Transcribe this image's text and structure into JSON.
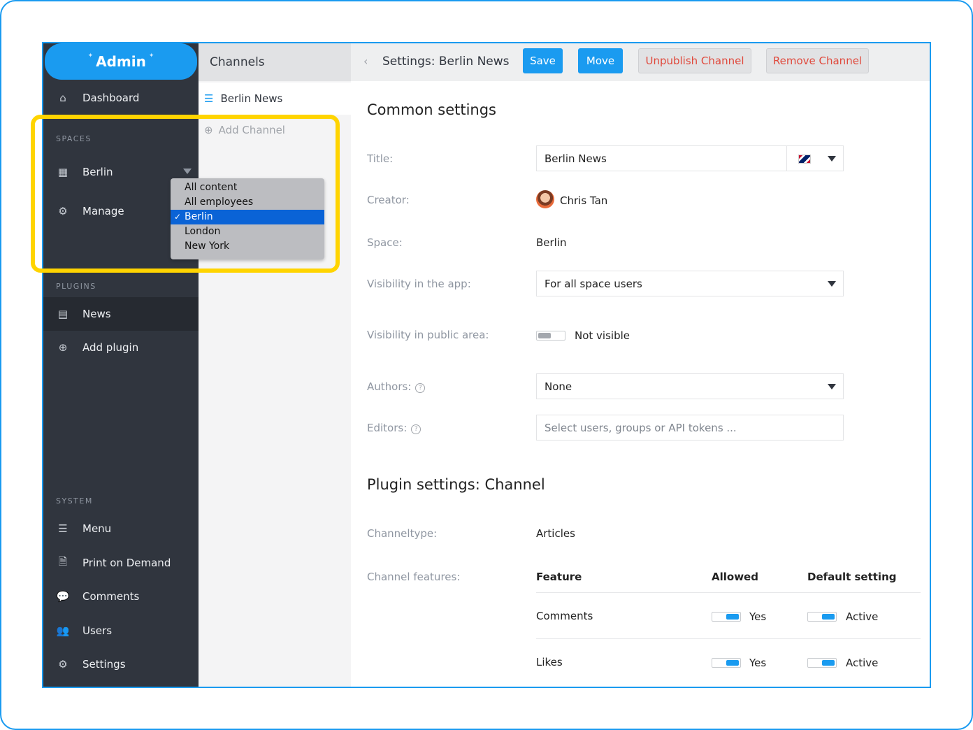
{
  "app": {
    "title": "Admin"
  },
  "sidebar": {
    "dashboard": "Dashboard",
    "spaces_label": "SPACES",
    "space_selected": "Berlin",
    "manage": "Manage",
    "plugins_label": "PLUGINS",
    "plugins": [
      {
        "label": "News"
      },
      {
        "label": "Add plugin"
      }
    ],
    "system_label": "SYSTEM",
    "system": [
      {
        "label": "Menu"
      },
      {
        "label": "Print on Demand"
      },
      {
        "label": "Comments"
      },
      {
        "label": "Users"
      },
      {
        "label": "Settings"
      }
    ]
  },
  "space_dropdown": {
    "options": [
      "All content",
      "All employees",
      "Berlin",
      "London",
      "New York"
    ],
    "selected": "Berlin"
  },
  "channels": {
    "header": "Channels",
    "items": [
      {
        "label": "Berlin News"
      }
    ],
    "add_label": "Add Channel"
  },
  "toolbar": {
    "title": "Settings: Berlin News",
    "save": "Save",
    "move": "Move",
    "unpublish": "Unpublish Channel",
    "remove": "Remove Channel"
  },
  "common": {
    "heading": "Common settings",
    "title_label": "Title:",
    "title_value": "Berlin News",
    "creator_label": "Creator:",
    "creator_value": "Chris Tan",
    "space_label": "Space:",
    "space_value": "Berlin",
    "vis_app_label": "Visibility in the app:",
    "vis_app_value": "For all space users",
    "vis_public_label": "Visibility in public area:",
    "vis_public_value": "Not visible",
    "authors_label": "Authors:",
    "authors_value": "None",
    "editors_label": "Editors:",
    "editors_placeholder": "Select users, groups or API tokens ..."
  },
  "plugin": {
    "heading": "Plugin settings: Channel",
    "channeltype_label": "Channeltype:",
    "channeltype_value": "Articles",
    "features_label": "Channel features:",
    "col_feature": "Feature",
    "col_allowed": "Allowed",
    "col_default": "Default setting",
    "features": [
      {
        "name": "Comments",
        "allowed": "Yes",
        "default": "Active"
      },
      {
        "name": "Likes",
        "allowed": "Yes",
        "default": "Active"
      }
    ]
  },
  "colors": {
    "accent": "#1a9bf0",
    "sidebar_bg": "#30353e",
    "danger": "#e0493c",
    "highlight": "#ffd400"
  }
}
